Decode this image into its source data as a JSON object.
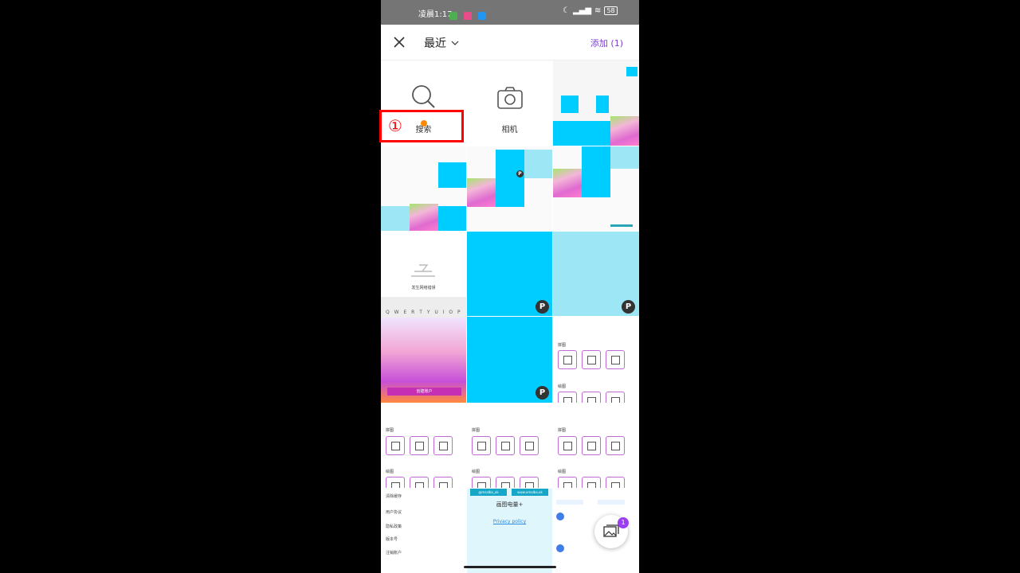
{
  "status_bar": {
    "time": "凌晨1:17",
    "battery": "58"
  },
  "header": {
    "album": "最近",
    "add_label": "添加 (1)"
  },
  "actions": {
    "search": "搜索",
    "camera": "相机"
  },
  "annotation": {
    "marker": "①"
  },
  "thumbs": {
    "offline_text": "发生网络错误",
    "keyboard_row": "Q W E R T Y U I O P",
    "pink_button": "创建账户",
    "section_a": "拼图",
    "section_b": "绘图",
    "settings_rows": [
      "清除缓存",
      "用户协议",
      "隐私政策",
      "版本号",
      "注销账户"
    ],
    "about_title": "画图电量+",
    "about_link": "Privacy policy",
    "social": [
      "@msalba_ok",
      "www.omalba.ok"
    ]
  },
  "fab_count": "1",
  "colors": {
    "accent": "#7a3fd0",
    "cyan": "#00cdff",
    "highlight": "#ff0000"
  }
}
